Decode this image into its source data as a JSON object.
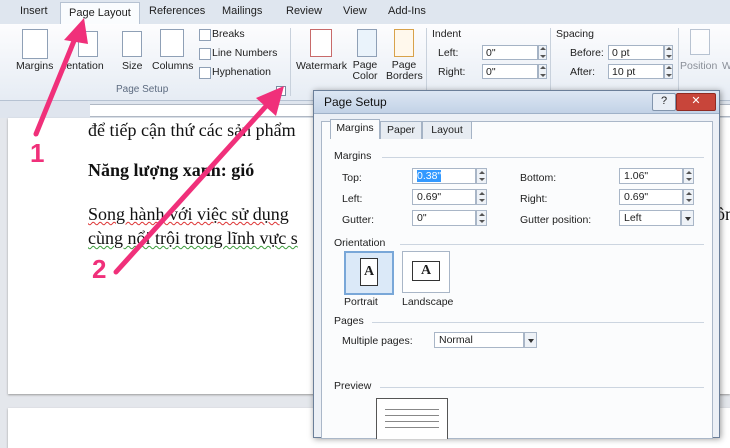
{
  "tabs": [
    "Insert",
    "Page Layout",
    "References",
    "Mailings",
    "Review",
    "View",
    "Add-Ins"
  ],
  "ribbon": {
    "margins": "Margins",
    "orientation": "ientation",
    "size": "Size",
    "columns": "Columns",
    "breaks": "Breaks",
    "line_numbers": "Line Numbers",
    "hyphenation": "Hyphenation",
    "page_setup_group": "Page Setup",
    "watermark": "Watermark",
    "page_color": "Page Color",
    "page_borders": "Page Borders",
    "indent_title": "Indent",
    "indent_left_label": "Left:",
    "indent_left_value": "0\"",
    "indent_right_label": "Right:",
    "indent_right_value": "0\"",
    "spacing_title": "Spacing",
    "spacing_before_label": "Before:",
    "spacing_before_value": "0 pt",
    "spacing_after_label": "After:",
    "spacing_after_value": "10 pt",
    "position": "Position",
    "wrap_text": "W T"
  },
  "document": {
    "line1": "để tiếp cận thứ các sản phẩm",
    "heading": "Năng lượng xanh: gió",
    "para_line1": "Song hành với việc sử dụng",
    "para_line1_tail": "ôn",
    "para_line2": "cùng nổi trội trong lĩnh vực s"
  },
  "annotations": {
    "num1": "1",
    "num2": "2"
  },
  "dialog": {
    "title": "Page Setup",
    "help": "?",
    "close": "✕",
    "tabs": [
      "Margins",
      "Paper",
      "Layout"
    ],
    "margins_section": "Margins",
    "top_label": "Top:",
    "top_value": "0.38\"",
    "bottom_label": "Bottom:",
    "bottom_value": "1.06\"",
    "left_label": "Left:",
    "left_value": "0.69\"",
    "right_label": "Right:",
    "right_value": "0.69\"",
    "gutter_label": "Gutter:",
    "gutter_value": "0\"",
    "gutter_pos_label": "Gutter position:",
    "gutter_pos_value": "Left",
    "orientation_section": "Orientation",
    "portrait": "Portrait",
    "landscape": "Landscape",
    "orientation_glyph": "A",
    "pages_section": "Pages",
    "multiple_pages_label": "Multiple pages:",
    "multiple_pages_value": "Normal",
    "preview_section": "Preview"
  },
  "colors": {
    "accent_arrow": "#f0307a",
    "selection": "#3399ff"
  }
}
